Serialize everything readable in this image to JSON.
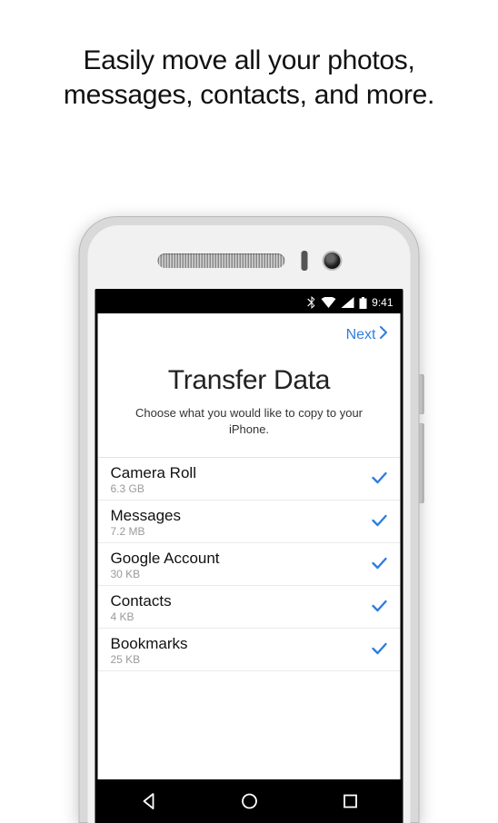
{
  "headline": "Easily move all your photos, messages, contacts, and more.",
  "status": {
    "time": "9:41"
  },
  "nav": {
    "next": "Next"
  },
  "screen": {
    "title": "Transfer Data",
    "subtitle": "Choose what you would like to copy to your iPhone."
  },
  "items": [
    {
      "name": "Camera Roll",
      "size": "6.3 GB"
    },
    {
      "name": "Messages",
      "size": "7.2 MB"
    },
    {
      "name": "Google Account",
      "size": "30 KB"
    },
    {
      "name": "Contacts",
      "size": "4 KB"
    },
    {
      "name": "Bookmarks",
      "size": "25 KB"
    }
  ]
}
